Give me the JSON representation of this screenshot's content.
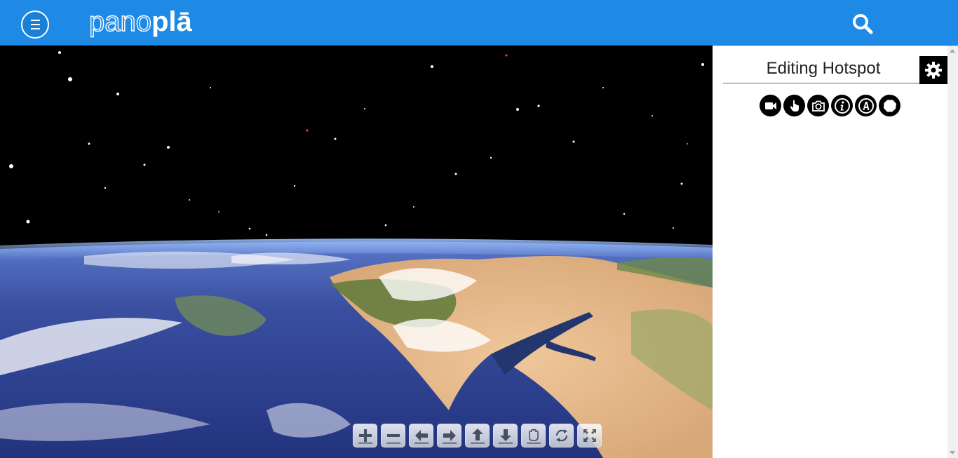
{
  "header": {
    "logo_light": "pano",
    "logo_bold": "plā",
    "menu_icon": "hamburger-icon",
    "search_icon": "search-icon",
    "background_color": "#1e8ae6"
  },
  "viewer": {
    "content": "panorama-earth-from-space",
    "controls": [
      {
        "name": "zoom-in-button",
        "icon": "plus-icon"
      },
      {
        "name": "zoom-out-button",
        "icon": "minus-icon"
      },
      {
        "name": "pan-left-button",
        "icon": "arrow-left-icon"
      },
      {
        "name": "pan-right-button",
        "icon": "arrow-right-icon"
      },
      {
        "name": "pan-up-button",
        "icon": "arrow-up-icon"
      },
      {
        "name": "pan-down-button",
        "icon": "arrow-down-icon"
      },
      {
        "name": "drag-mode-button",
        "icon": "hand-icon"
      },
      {
        "name": "auto-rotate-button",
        "icon": "rotate-icon"
      },
      {
        "name": "fullscreen-button",
        "icon": "fullscreen-icon"
      }
    ]
  },
  "panel": {
    "title": "Editing Hotspot",
    "settings_icon": "gear-icon",
    "hotspot_types": [
      {
        "name": "video-hotspot",
        "icon": "video-camera-icon"
      },
      {
        "name": "link-hotspot",
        "icon": "hand-pointer-icon"
      },
      {
        "name": "photo-hotspot",
        "icon": "camera-icon"
      },
      {
        "name": "info-hotspot",
        "icon": "info-icon"
      },
      {
        "name": "text-hotspot",
        "icon": "letter-a-icon"
      },
      {
        "name": "polygon-hotspot",
        "icon": "polygon-icon"
      }
    ]
  }
}
